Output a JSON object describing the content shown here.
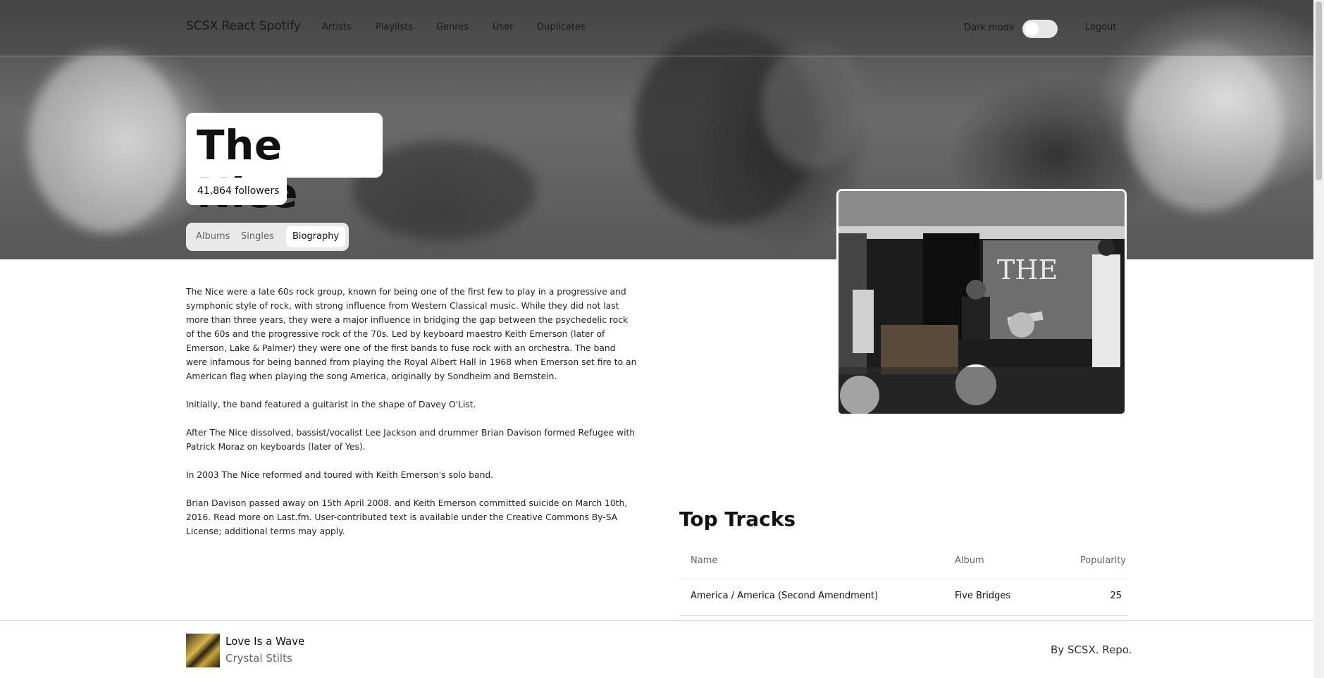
{
  "nav": {
    "brand": "SCSX React Spotify",
    "links": [
      "Artists",
      "Playlists",
      "Genres",
      "User",
      "Duplicates"
    ],
    "dark_mode_label": "Dark mode",
    "dark_mode_on": false,
    "logout": "Logout"
  },
  "artist": {
    "name": "The Nice",
    "followers": "41,864 followers"
  },
  "tabs": [
    {
      "label": "Albums",
      "active": false
    },
    {
      "label": "Singles",
      "active": false
    },
    {
      "label": "Biography",
      "active": true
    }
  ],
  "biography": [
    "The Nice were a late 60s rock group, known for being one of the first few to play in a progressive and symphonic style of rock, with strong influence from Western Classical music. While they did not last more than three years, they were a major influence in bridging the gap between the psychedelic rock of the 60s and the progressive rock of the 70s. Led by keyboard maestro Keith Emerson (later of Emerson, Lake & Palmer) they were one of the first bands to fuse rock with an orchestra. The band were infamous for being banned from playing the Royal Albert Hall in 1968 when Emerson set fire to an American flag when playing the song America, originally by Sondheim and Bernstein.",
    "Initially, the band featured a guitarist in the shape of Davey O'List.",
    "After The Nice dissolved, bassist/vocalist Lee Jackson and drummer Brian Davison formed Refugee with Patrick Moraz on keyboards (later of Yes).",
    "In 2003 The Nice reformed and toured with Keith Emerson's solo band.",
    "Brian Davison passed away on 15th April 2008. and Keith Emerson committed suicide on March 10th, 2016. Read more on Last.fm. User-contributed text is available under the Creative Commons By-SA License; additional terms may apply."
  ],
  "top_tracks": {
    "title": "Top Tracks",
    "columns": [
      "Name",
      "Album",
      "Popularity"
    ],
    "rows": [
      {
        "name": "America / America (Second Amendment)",
        "album": "Five Bridges",
        "popularity": "25"
      }
    ]
  },
  "player": {
    "song": "Love Is a Wave",
    "artist": "Crystal Stilts"
  },
  "footer": {
    "credit": "By SCSX. Repo."
  }
}
